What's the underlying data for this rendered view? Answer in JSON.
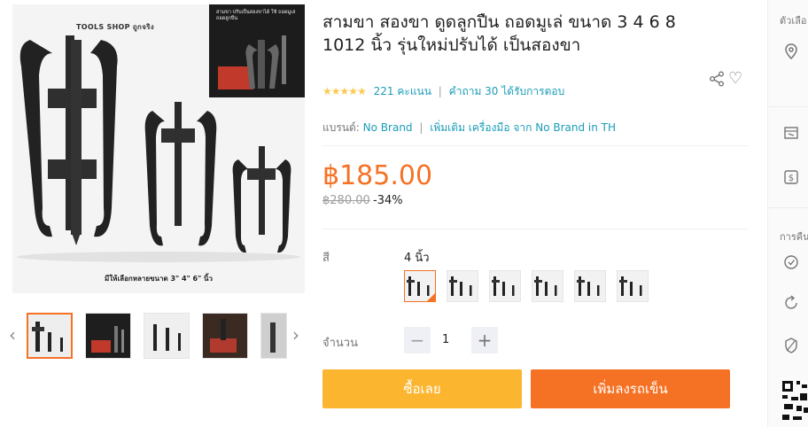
{
  "product": {
    "title": "สามขา สองขา ดูดลูกปืน ถอดมูเล่ ขนาด 3 4 6 8 1012 นิ้ว รุ่นใหม่ปรับได้ เป็นสองขา",
    "rating_stars": "★★★★★",
    "rating_count": "221 คะแนน",
    "qa_text": "คำถาม 30 ได้รับการตอบ",
    "brand_label": "แบรนด์:",
    "brand_name": "No Brand",
    "brand_more": "เพิ่มเติม เครื่องมือ จาก No Brand in TH",
    "price": "฿185.00",
    "original_price": "฿280.00",
    "discount": "-34%",
    "color_label": "สี",
    "color_value": "4 นิ้ว",
    "color_options_count": 6,
    "quantity_label": "จำนวน",
    "quantity": "1",
    "minus": "−",
    "plus": "+",
    "buy_now": "ซื้อเลย",
    "add_to_cart": "เพิ่มลงรถเข็น"
  },
  "gallery": {
    "shop_banner": "TOOLS SHOP ถูกจริง",
    "inset_text": "สามขา ปรับเป็นสองขาได้ ใช้ ถอดมูเล่ ถอดลูกปืน",
    "caption": "มีให้เลือกหลายขนาด 3\"  4\"  6\"  นิ้ว",
    "prev": "‹",
    "next": "›"
  },
  "sidebar": {
    "delivery_label": "ตัวเลือ",
    "returns_label": "การคืน"
  },
  "colors": {
    "accent": "#f57224",
    "buy": "#fbb52f",
    "link": "#1a9cb7",
    "star": "#faca51"
  }
}
